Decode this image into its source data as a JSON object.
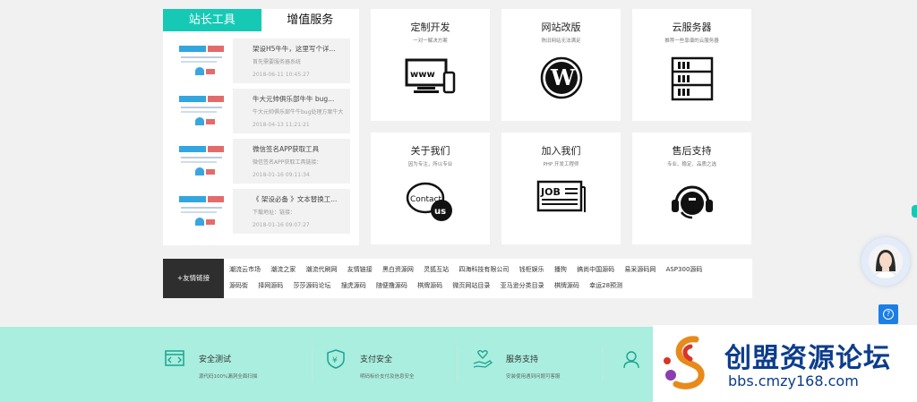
{
  "tabs": [
    {
      "label": "站长工具",
      "active": true
    },
    {
      "label": "增值服务",
      "active": false
    }
  ],
  "articles": [
    {
      "title": "架设H5牛牛，这里写个详...",
      "desc": "首先需要服务器系统",
      "date": "2018-06-11 10:45:27"
    },
    {
      "title": "牛大元帅俱乐部牛牛 bug...",
      "desc": "牛大元帅俱乐部牛牛bug处理方案牛大",
      "date": "2018-04-13 11:21:21"
    },
    {
      "title": "微信签名APP获取工具",
      "desc": "微信签名APP获取工具链接：",
      "date": "2018-01-16 09:11:34"
    },
    {
      "title": "《 架设必备 》文本替换工...",
      "desc": "下载地址：链接：",
      "date": "2018-01-16 09:07:27"
    }
  ],
  "services": [
    {
      "title": "定制开发",
      "sub": "一对一解决方案",
      "icon": "www-monitor-phone-icon"
    },
    {
      "title": "网站改版",
      "sub": "陈旧网站无法满足",
      "icon": "wordpress-icon"
    },
    {
      "title": "云服务器",
      "sub": "推荐一些靠谱的云服务器",
      "icon": "server-rack-icon"
    },
    {
      "title": "关于我们",
      "sub": "因为专注，所以专业",
      "icon": "contact-us-bubble-icon"
    },
    {
      "title": "加入我们",
      "sub": "PHP 开发工程师",
      "icon": "job-newspaper-icon"
    },
    {
      "title": "售后支持",
      "sub": "专业、稳定、品质之选",
      "icon": "headset-support-icon"
    }
  ],
  "friend_links": {
    "label": "+友情链接",
    "items": [
      "潮流云市场",
      "潮流之家",
      "潮流代刷网",
      "友情链接",
      "黑白资源网",
      "灵狐互站",
      "四海科技有限公司",
      "钱柜娱乐",
      "播狗",
      "搞尚中国源码",
      "易采源码网",
      "ASP300源码",
      "源码街",
      "择网源码",
      "莎莎源码论坛",
      "搜虎源码",
      "随便撸源码",
      "棋牌源码",
      "微页网站目录",
      "亚马逊分类目录",
      "棋牌源码",
      "幸运28预测"
    ]
  },
  "footer_features": [
    {
      "title": "安全测试",
      "desc": "源代码100%漏洞全面扫描",
      "icon": "code-window-icon"
    },
    {
      "title": "支付安全",
      "desc": "明码标价支付及信息安全",
      "icon": "shield-yen-icon"
    },
    {
      "title": "服务支持",
      "desc": "安装使用遇到问题可客服",
      "icon": "hand-heart-icon"
    },
    {
      "title": "",
      "desc": "",
      "icon": "customer-agent-icon"
    }
  ],
  "watermark": {
    "name": "创盟资源论坛",
    "url": "bbs.cmzy168.com"
  },
  "floating": {
    "help_glyph": "?"
  },
  "colors": {
    "accent": "#16c9b5",
    "footer_bg": "#a9eedf",
    "watermark_blue": "#0c3c8c",
    "help_blue": "#1b7fe5"
  }
}
